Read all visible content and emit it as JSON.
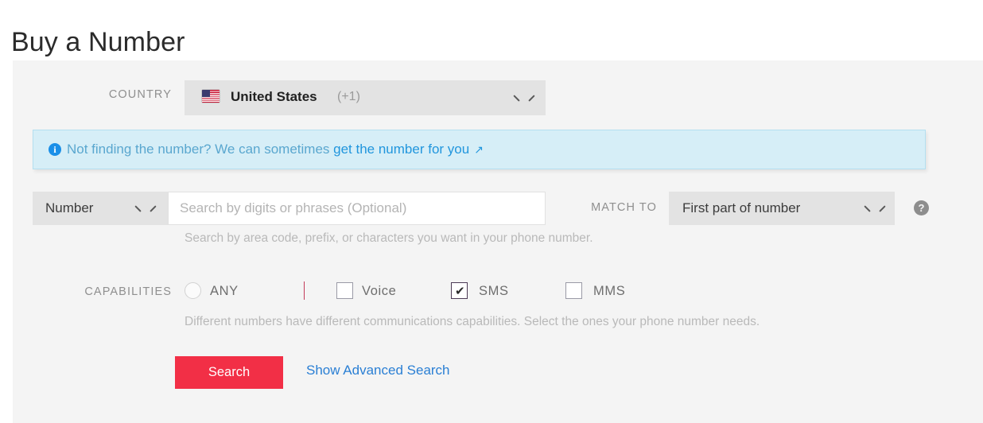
{
  "page": {
    "title": "Buy a Number"
  },
  "country": {
    "label": "COUNTRY",
    "flag_icon": "us-flag-icon",
    "name": "United States",
    "dial_code": "(+1)",
    "chevron_icon": "chevron-down-icon"
  },
  "banner": {
    "info_icon": "info-icon",
    "text": "Not finding the number? We can sometimes ",
    "link_text": "get the number for you",
    "external_icon": "↗"
  },
  "search": {
    "type_value": "Number",
    "type_chevron_icon": "chevron-down-icon",
    "placeholder": "Search by digits or phrases (Optional)",
    "value": "",
    "match_to_label": "MATCH TO",
    "match_to_value": "First part of number",
    "match_to_chevron_icon": "chevron-down-icon",
    "help_icon": "help-icon",
    "help_glyph": "?",
    "hint": "Search by area code, prefix, or characters you want in your phone number."
  },
  "capabilities": {
    "label": "CAPABILITIES",
    "hint": "Different numbers have different communications capabilities. Select the ones your phone number needs.",
    "any": {
      "label": "ANY",
      "selected": false
    },
    "options": [
      {
        "label": "Voice",
        "checked": false
      },
      {
        "label": "SMS",
        "checked": true
      },
      {
        "label": "MMS",
        "checked": false
      }
    ],
    "check_glyph": "✔"
  },
  "actions": {
    "search_label": "Search",
    "advanced_label": "Show Advanced Search"
  },
  "colors": {
    "accent_red": "#f22f46",
    "link_blue": "#2a7fd4",
    "banner_bg": "#d6eef7",
    "panel_bg": "#f4f4f4",
    "control_bg": "#e3e3e3"
  }
}
